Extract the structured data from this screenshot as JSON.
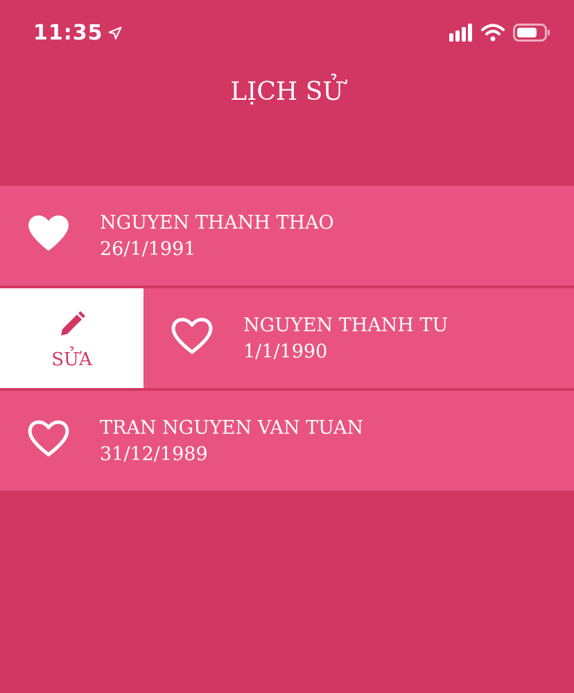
{
  "status_bar": {
    "time": "11:35"
  },
  "header": {
    "title": "LỊCH SỬ"
  },
  "history": {
    "items": [
      {
        "name": "NGUYEN THANH THAO",
        "date": "26/1/1991",
        "favorite": true
      },
      {
        "name": "NGUYEN THANH TU",
        "date": "1/1/1990",
        "favorite": false,
        "swipe_action": "SỬA"
      },
      {
        "name": "TRAN NGUYEN VAN TUAN",
        "date": "31/12/1989",
        "favorite": false
      }
    ]
  },
  "icons": {
    "heart_filled": "heart-filled-icon",
    "heart_outline": "heart-outline-icon",
    "pencil": "pencil-icon",
    "location": "location-arrow-icon",
    "signal": "signal-icon",
    "wifi": "wifi-icon",
    "battery": "battery-icon"
  },
  "colors": {
    "background": "#d23763",
    "row": "#e95382",
    "white": "#ffffff"
  }
}
